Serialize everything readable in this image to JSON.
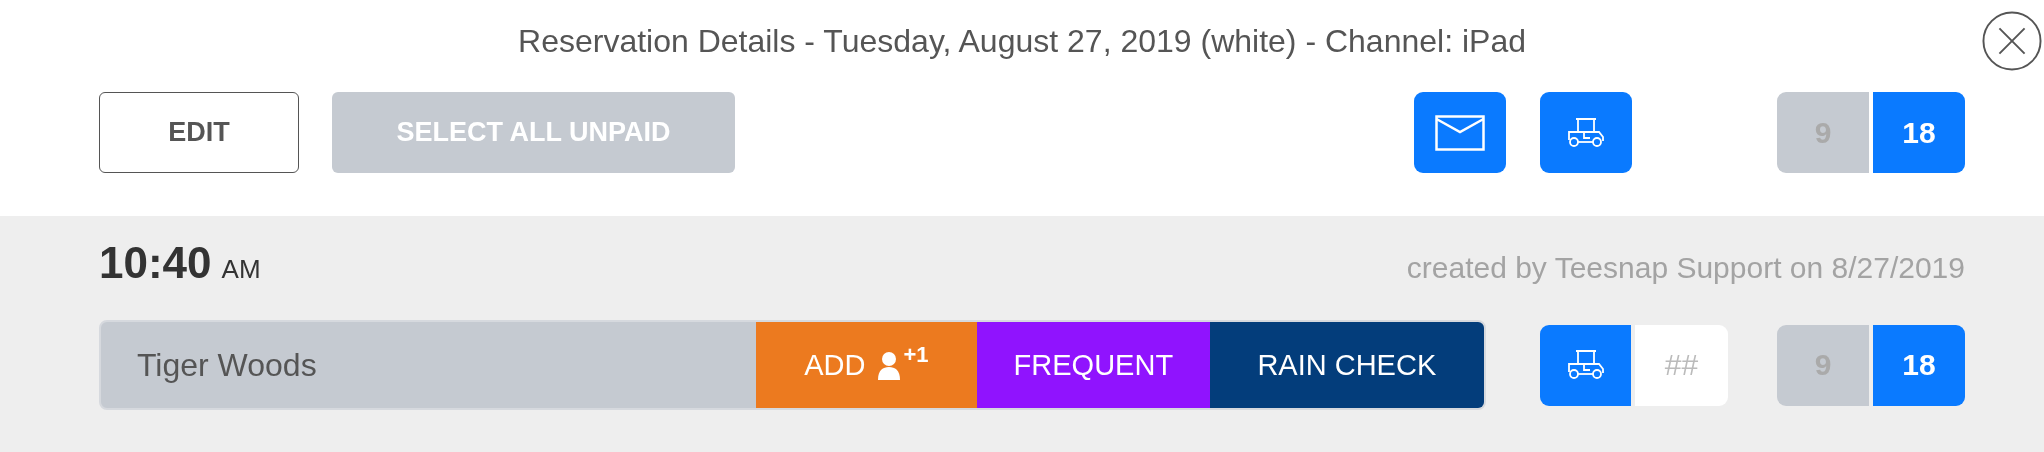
{
  "title": "Reservation Details - Tuesday, August 27, 2019 (white) - Channel: iPad",
  "toolbar": {
    "buttons": [
      {
        "label": "EDIT",
        "disabled": false
      },
      {
        "label": "SELECT ALL UNPAID",
        "disabled": true
      }
    ],
    "holes": [
      {
        "label": "9",
        "selected": false
      },
      {
        "label": "18",
        "selected": true
      }
    ]
  },
  "reservation": {
    "time": "10:40",
    "period": "AM",
    "created": "created by Teesnap Support on 8/27/2019",
    "players": [
      {
        "name": "Tiger Woods",
        "actions": [
          {
            "label": "ADD",
            "kind": "add",
            "badge": "+1",
            "color": "#ec7a1f"
          },
          {
            "label": "FREQUENT",
            "kind": "plain",
            "color": "#9013fe"
          },
          {
            "label": "RAIN CHECK",
            "kind": "plain",
            "color": "#033d7b"
          }
        ],
        "cart_placeholder": "##",
        "holes": [
          {
            "label": "9",
            "selected": false
          },
          {
            "label": "18",
            "selected": true
          }
        ]
      }
    ]
  }
}
